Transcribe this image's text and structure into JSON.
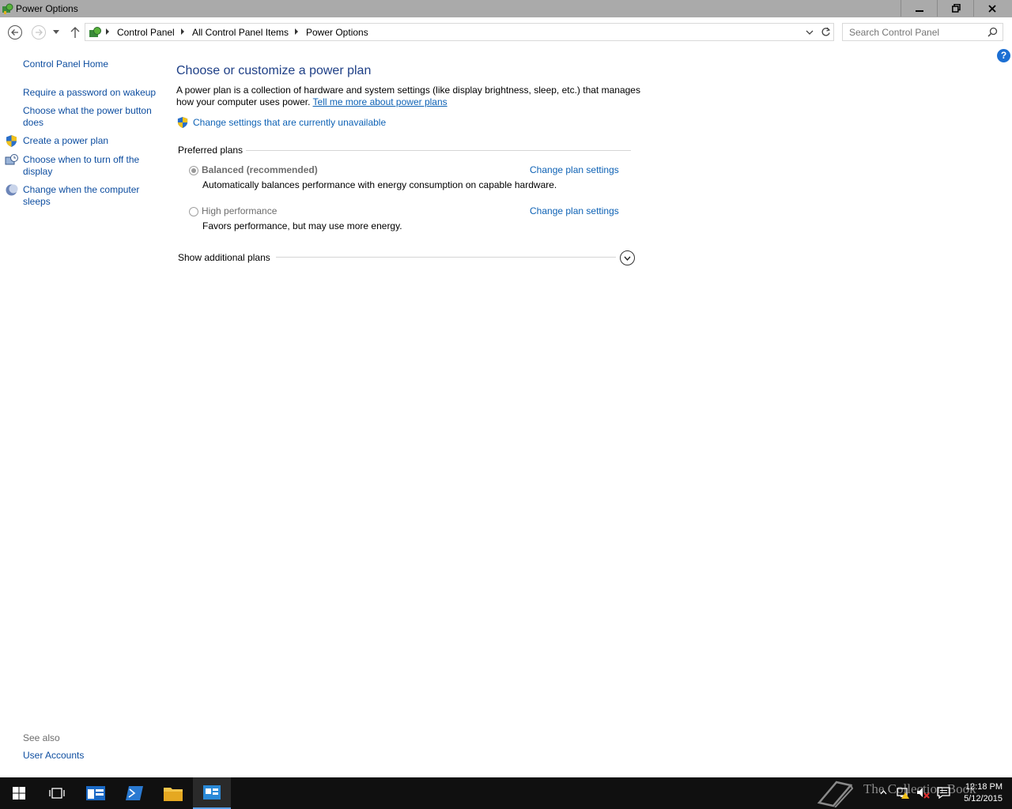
{
  "window": {
    "title": "Power Options",
    "minimize_label": "Minimize",
    "maximize_label": "Restore",
    "close_label": "Close"
  },
  "address": {
    "crumbs": [
      "Control Panel",
      "All Control Panel Items",
      "Power Options"
    ]
  },
  "search": {
    "placeholder": "Search Control Panel"
  },
  "sidebar": {
    "home": "Control Panel Home",
    "items": [
      {
        "label": "Require a password on wakeup",
        "icon": "none"
      },
      {
        "label": "Choose what the power button does",
        "icon": "none"
      },
      {
        "label": "Create a power plan",
        "icon": "shield-icon"
      },
      {
        "label": "Choose when to turn off the display",
        "icon": "monitor-clock-icon"
      },
      {
        "label": "Change when the computer sleeps",
        "icon": "moon-icon"
      }
    ],
    "see_also_title": "See also",
    "see_also_items": [
      "User Accounts"
    ]
  },
  "main": {
    "title": "Choose or customize a power plan",
    "description": "A power plan is a collection of hardware and system settings (like display brightness, sleep, etc.) that manages how your computer uses power.",
    "learn_more": "Tell me more about power plans",
    "unavailable_link": "Change settings that are currently unavailable",
    "preferred_label": "Preferred plans",
    "plans": [
      {
        "name": "Balanced (recommended)",
        "description": "Automatically balances performance with energy consumption on capable hardware.",
        "selected": true,
        "change_label": "Change plan settings"
      },
      {
        "name": "High performance",
        "description": "Favors performance, but may use more energy.",
        "selected": false,
        "change_label": "Change plan settings"
      }
    ],
    "additional_label": "Show additional plans"
  },
  "taskbar": {
    "watermark": "The Collection Book",
    "time": "12:18 PM",
    "date": "5/12/2015"
  },
  "colors": {
    "link": "#0e62b5",
    "title": "#1e3f86",
    "titlebar": "#aaaaaa",
    "taskbar": "#101010"
  }
}
